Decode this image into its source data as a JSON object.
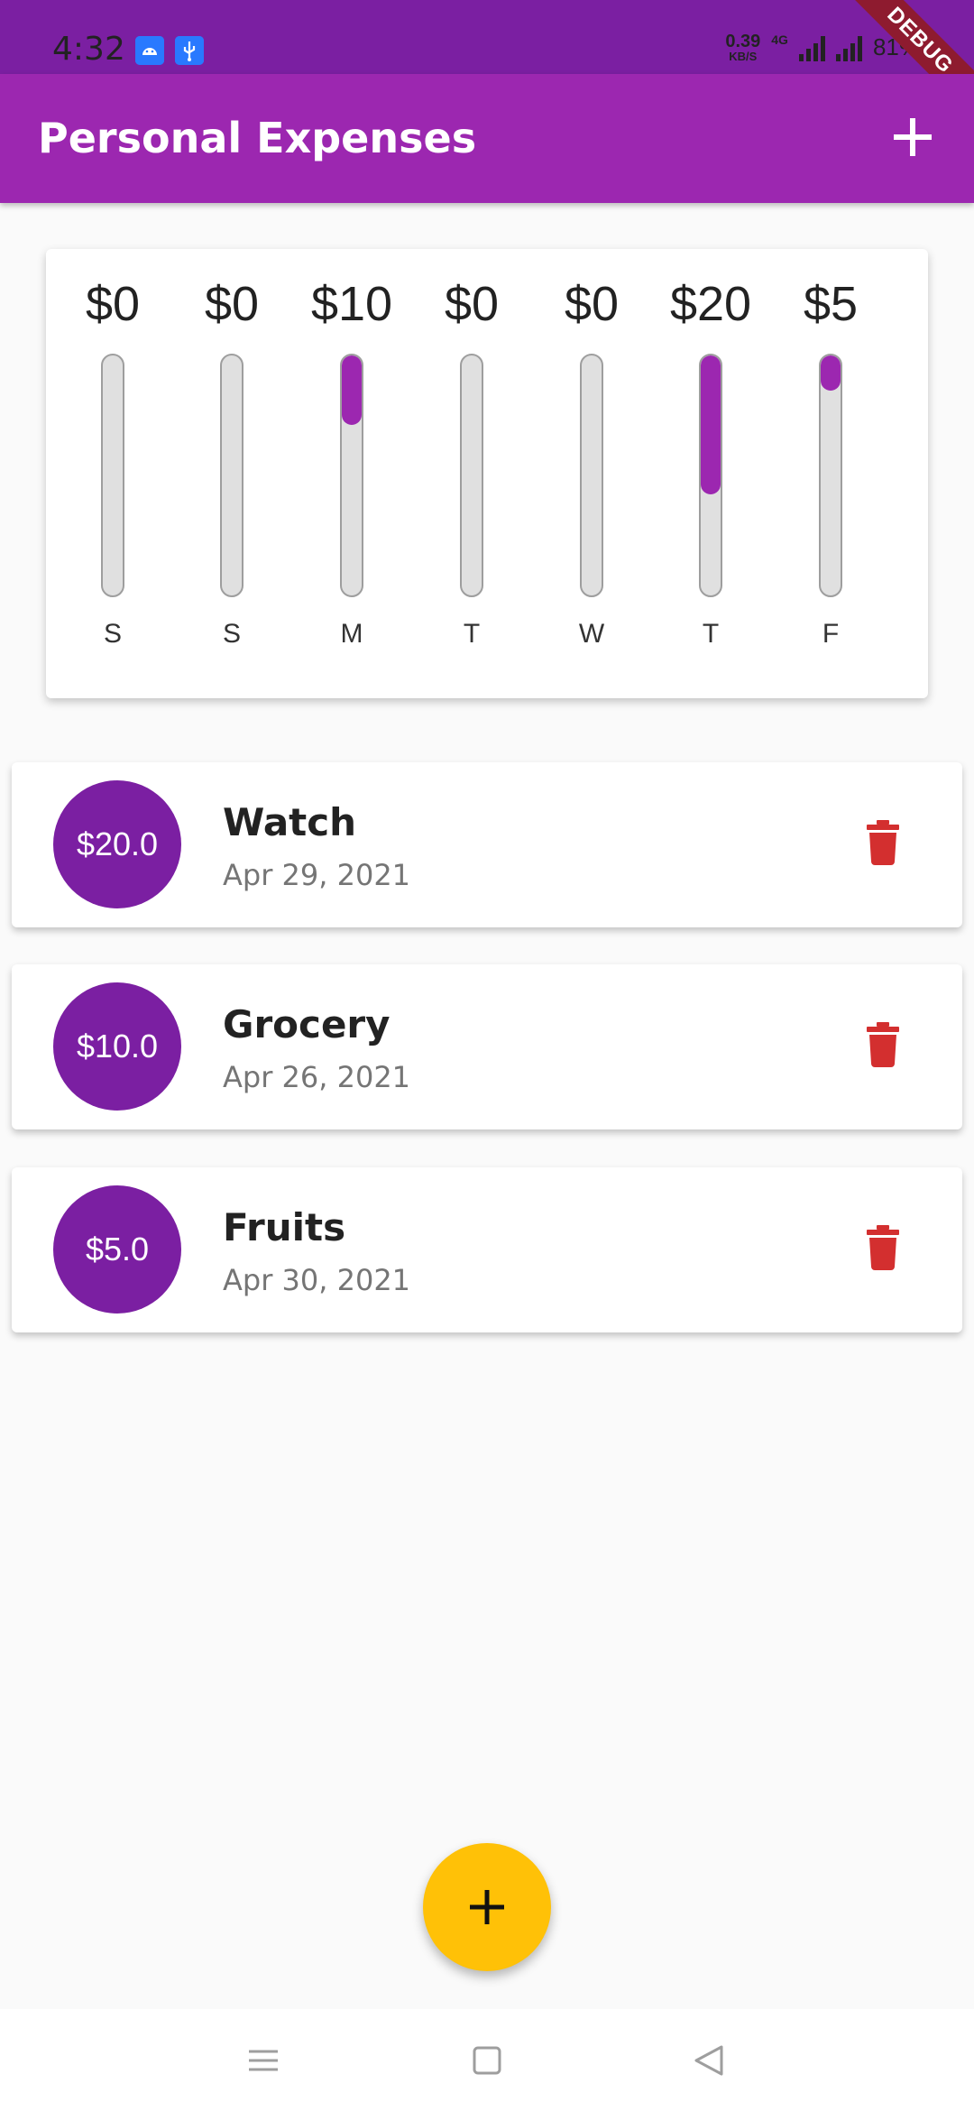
{
  "status_bar": {
    "time": "4:32",
    "net_speed": "0.39",
    "net_unit": "KB/S",
    "network_type": "4G",
    "battery": "81%",
    "icons": [
      "android-notification-icon",
      "usb-icon",
      "signal-icon",
      "battery-icon"
    ]
  },
  "debug_banner": "DEBUG",
  "app_bar": {
    "title": "Personal Expenses",
    "action_icon": "plus-icon"
  },
  "chart_data": {
    "type": "bar",
    "categories": [
      "S",
      "S",
      "M",
      "T",
      "W",
      "T",
      "F"
    ],
    "labels": [
      "$0",
      "$0",
      "$10",
      "$0",
      "$0",
      "$20",
      "$5"
    ],
    "values": [
      0,
      0,
      10,
      0,
      0,
      20,
      5
    ],
    "fill_fraction": [
      0,
      0,
      0.2857,
      0,
      0,
      0.5714,
      0.1429
    ],
    "bar_color": "#9c27b0",
    "track_color": "#e0e0e0"
  },
  "transactions": [
    {
      "amount": "$20.0",
      "title": "Watch",
      "date": "Apr 29, 2021"
    },
    {
      "amount": "$10.0",
      "title": "Grocery",
      "date": "Apr 26, 2021"
    },
    {
      "amount": "$5.0",
      "title": "Fruits",
      "date": "Apr 30, 2021"
    }
  ],
  "colors": {
    "primary": "#9c27b0",
    "primary_dark": "#7b1fa2",
    "accent": "#ffc107",
    "delete": "#d32f2f"
  },
  "fab": {
    "icon": "plus-icon"
  },
  "nav_bar": {
    "icons": [
      "menu-icon",
      "home-icon",
      "back-icon"
    ]
  }
}
